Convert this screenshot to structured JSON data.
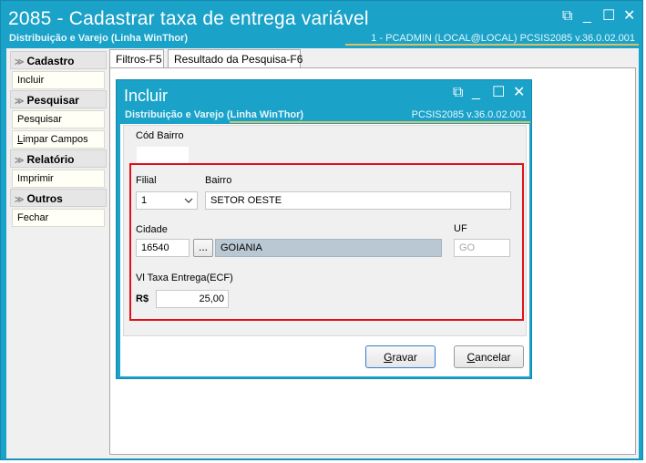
{
  "main": {
    "title": "2085 - Cadastrar taxa de entrega variável",
    "subtitle": "Distribuição e Varejo (Linha WinThor)",
    "info": "1 - PCADMIN (LOCAL@LOCAL)   PCSIS2085  v.36.0.02.001",
    "controls": {
      "restore": "⧉",
      "minimize": "_",
      "maximize": "☐",
      "close": "✕"
    }
  },
  "sidebar": {
    "sections": [
      {
        "header": "Cadastro",
        "items": [
          "Incluir"
        ]
      },
      {
        "header": "Pesquisar",
        "items": [
          "Pesquisar",
          "Limpar Campos"
        ]
      },
      {
        "header": "Relatório",
        "items": [
          "Imprimir"
        ]
      },
      {
        "header": "Outros",
        "items": [
          "Fechar"
        ]
      }
    ]
  },
  "tabs": [
    "Filtros-F5",
    "Resultado da Pesquisa-F6"
  ],
  "dialog": {
    "title": "Incluir",
    "subtitle": "Distribuição e Varejo (Linha WinThor)",
    "info": "PCSIS2085  v.36.0.02.001",
    "cod_bairro_label": "Cód Bairro",
    "cod_bairro_value": "",
    "filial_label": "Filial",
    "filial_value": "1",
    "bairro_label": "Bairro",
    "bairro_value": "SETOR OESTE",
    "cidade_label": "Cidade",
    "cidade_code": "16540",
    "lookup_button": "...",
    "cidade_name": "GOIANIA",
    "uf_label": "UF",
    "uf_value": "GO",
    "taxa_label": "Vl Taxa Entrega(ECF)",
    "currency": "R$",
    "taxa_value": "25,00",
    "gravar_rest": "ravar",
    "gravar_key": "G",
    "cancelar_rest": "ancelar",
    "cancelar_key": "C"
  }
}
